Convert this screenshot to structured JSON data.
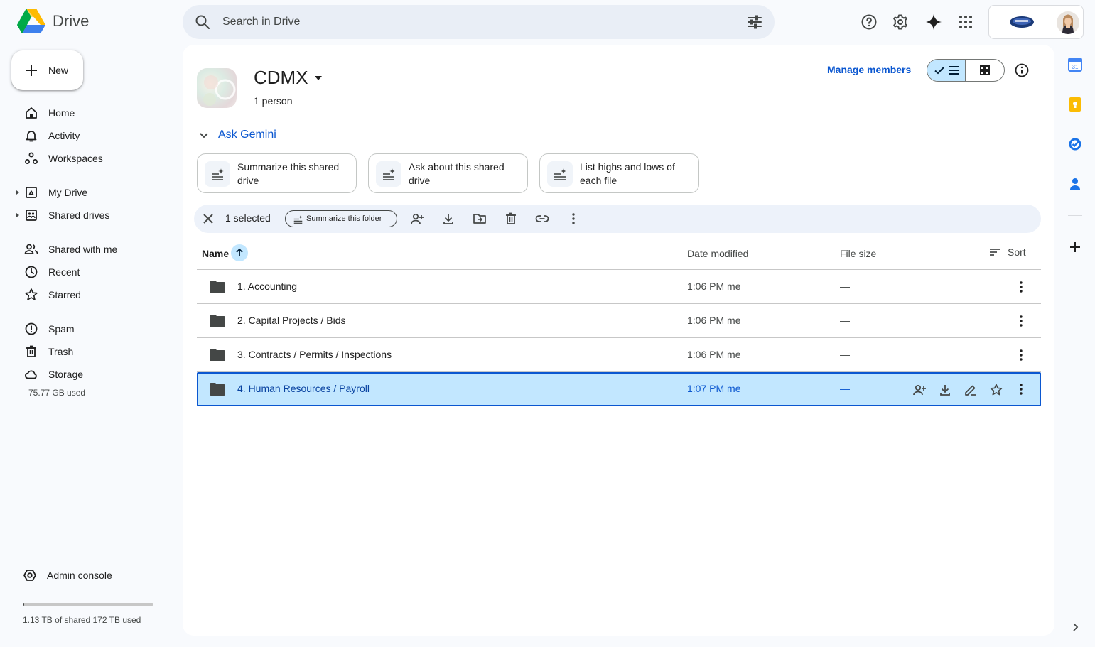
{
  "app": {
    "name": "Drive"
  },
  "search": {
    "placeholder": "Search in Drive"
  },
  "sidebar": {
    "new_label": "New",
    "items": [
      {
        "label": "Home",
        "icon": "home-icon"
      },
      {
        "label": "Activity",
        "icon": "bell-icon"
      },
      {
        "label": "Workspaces",
        "icon": "workspaces-icon"
      },
      {
        "label": "My Drive",
        "icon": "my-drive-icon"
      },
      {
        "label": "Shared drives",
        "icon": "shared-drives-icon"
      },
      {
        "label": "Shared with me",
        "icon": "people-icon"
      },
      {
        "label": "Recent",
        "icon": "clock-icon"
      },
      {
        "label": "Starred",
        "icon": "star-icon"
      },
      {
        "label": "Spam",
        "icon": "spam-icon"
      },
      {
        "label": "Trash",
        "icon": "trash-icon"
      },
      {
        "label": "Storage",
        "icon": "cloud-icon"
      }
    ],
    "storage_used": "75.77 GB used",
    "admin_label": "Admin console",
    "quota_text": "1.13 TB of shared 172 TB used",
    "quota_fraction": 0.0066
  },
  "header": {
    "drive_name": "CDMX",
    "members": "1 person",
    "manage_members": "Manage members"
  },
  "gemini": {
    "label": "Ask Gemini",
    "chips": [
      "Summarize this shared drive",
      "Ask about this shared drive",
      "List highs and lows of each file"
    ]
  },
  "action_bar": {
    "selected_count": "1 selected",
    "summarize_label": "Summarize this folder"
  },
  "table": {
    "columns": {
      "name": "Name",
      "date": "Date modified",
      "size": "File size",
      "sort": "Sort"
    },
    "rows": [
      {
        "name": "1. Accounting",
        "date": "1:06 PM me",
        "size": "—",
        "selected": false
      },
      {
        "name": "2. Capital Projects / Bids",
        "date": "1:06 PM me",
        "size": "—",
        "selected": false
      },
      {
        "name": "3. Contracts / Permits / Inspections",
        "date": "1:06 PM me",
        "size": "—",
        "selected": false
      },
      {
        "name": "4. Human Resources / Payroll",
        "date": "1:07 PM me",
        "size": "—",
        "selected": true
      }
    ]
  },
  "colors": {
    "accent": "#0b57d0",
    "selected_bg": "#c2e7ff",
    "surface": "#f8fafd"
  }
}
